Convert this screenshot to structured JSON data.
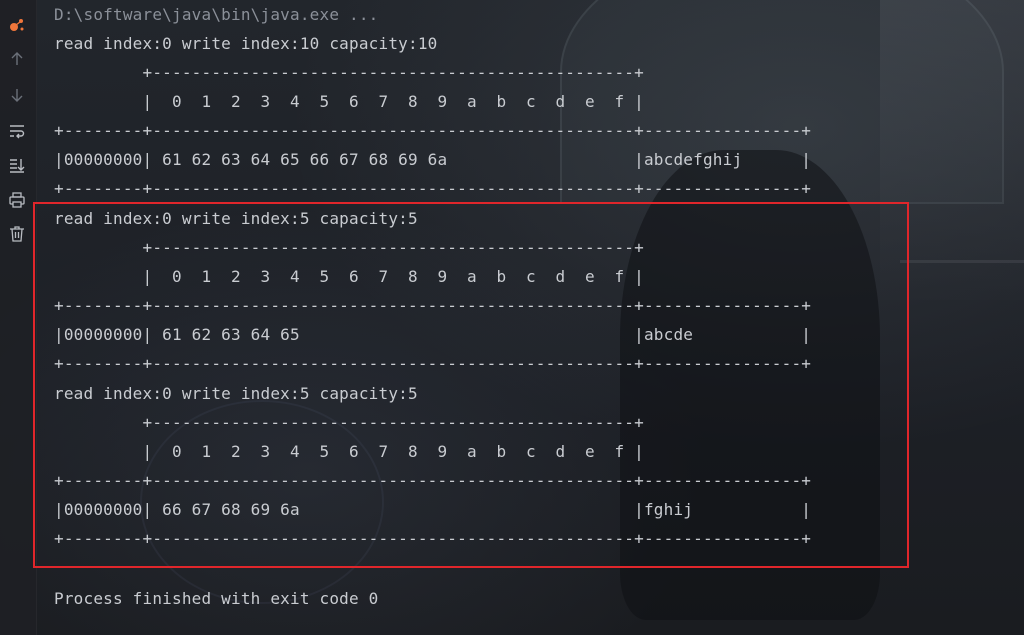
{
  "toolbar": {
    "items": [
      "run-icon",
      "up-arrow-icon",
      "down-arrow-icon",
      "soft-wrap-icon",
      "scroll-to-end-icon",
      "print-icon",
      "trash-icon"
    ]
  },
  "console": {
    "command": "D:\\software\\java\\bin\\java.exe ...",
    "blocks": [
      {
        "header": "read index:0 write index:10 capacity:10",
        "top_border": "         +-------------------------------------------------+",
        "column_row": "         |  0  1  2  3  4  5  6  7  8  9  a  b  c  d  e  f |",
        "separator": "+--------+-------------------------------------------------+----------------+",
        "data_row": "|00000000| 61 62 63 64 65 66 67 68 69 6a                   |abcdefghij      |",
        "bottom_border": "+--------+-------------------------------------------------+----------------+"
      },
      {
        "header": "read index:0 write index:5 capacity:5",
        "top_border": "         +-------------------------------------------------+",
        "column_row": "         |  0  1  2  3  4  5  6  7  8  9  a  b  c  d  e  f |",
        "separator": "+--------+-------------------------------------------------+----------------+",
        "data_row": "|00000000| 61 62 63 64 65                                  |abcde           |",
        "bottom_border": "+--------+-------------------------------------------------+----------------+"
      },
      {
        "header": "read index:0 write index:5 capacity:5",
        "top_border": "         +-------------------------------------------------+",
        "column_row": "         |  0  1  2  3  4  5  6  7  8  9  a  b  c  d  e  f |",
        "separator": "+--------+-------------------------------------------------+----------------+",
        "data_row": "|00000000| 66 67 68 69 6a                                  |fghij           |",
        "bottom_border": "+--------+-------------------------------------------------+----------------+"
      }
    ],
    "exit_message": "Process finished with exit code 0"
  },
  "colors": {
    "text": "#c9ccd1",
    "highlight_border": "#e0262b",
    "run_icon": "#f0763b"
  }
}
